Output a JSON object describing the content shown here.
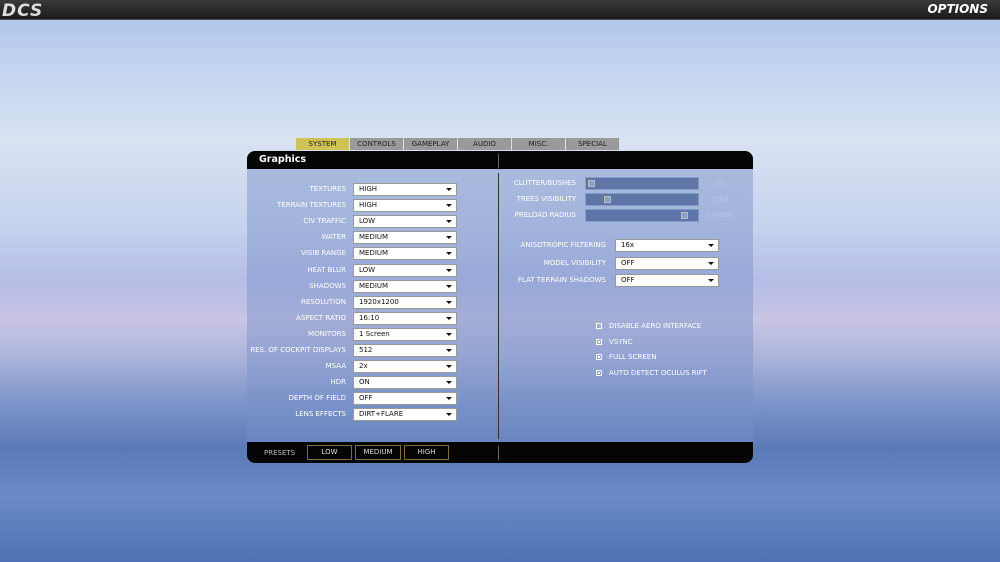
{
  "topbar": {
    "logo": "DCS",
    "title": "OPTIONS"
  },
  "tabs": [
    "SYSTEM",
    "CONTROLS",
    "GAMEPLAY",
    "AUDIO",
    "MISC.",
    "SPECIAL"
  ],
  "active_tab": "SYSTEM",
  "section_title": "Graphics",
  "left_settings": [
    {
      "label": "TEXTURES",
      "value": "HIGH"
    },
    {
      "label": "TERRAIN TEXTURES",
      "value": "HIGH"
    },
    {
      "label": "CIV TRAFFIC",
      "value": "LOW"
    },
    {
      "label": "WATER",
      "value": "MEDIUM"
    },
    {
      "label": "VISIB RANGE",
      "value": "MEDIUM"
    },
    {
      "label": "HEAT BLUR",
      "value": "LOW"
    },
    {
      "label": "SHADOWS",
      "value": "MEDIUM"
    },
    {
      "label": "RESOLUTION",
      "value": "1920x1200"
    },
    {
      "label": "ASPECT RATIO",
      "value": "16:10"
    },
    {
      "label": "MONITORS",
      "value": "1 Screen"
    },
    {
      "label": "RES. OF COCKPIT DISPLAYS",
      "value": "512"
    },
    {
      "label": "MSAA",
      "value": "2x"
    },
    {
      "label": "HDR",
      "value": "ON"
    },
    {
      "label": "DEPTH OF FIELD",
      "value": "OFF"
    },
    {
      "label": "LENS EFFECTS",
      "value": "DIRT+FLARE"
    }
  ],
  "sliders": [
    {
      "label": "CLUTTER/BUSHES",
      "value": "0",
      "fraction": 0.0
    },
    {
      "label": "TREES VISIBILITY",
      "value": "3762",
      "fraction": 0.16
    },
    {
      "label": "PRELOAD RADIUS",
      "value": "149990",
      "fraction": 0.93
    }
  ],
  "right_settings": [
    {
      "label": "ANISOTROPIC FILTERING",
      "value": "16x"
    },
    {
      "label": "MODEL VISIBILITY",
      "value": "OFF"
    },
    {
      "label": "FLAT TERRAIN SHADOWS",
      "value": "OFF"
    }
  ],
  "checkboxes": [
    {
      "label": "DISABLE AERO INTERFACE",
      "checked": false
    },
    {
      "label": "VSYNC",
      "checked": true
    },
    {
      "label": "FULL SCREEN",
      "checked": true
    },
    {
      "label": "AUTO DETECT OCULUS RIFT",
      "checked": true
    }
  ],
  "presets": {
    "label": "PRESETS",
    "buttons": [
      "LOW",
      "MEDIUM",
      "HIGH"
    ]
  }
}
